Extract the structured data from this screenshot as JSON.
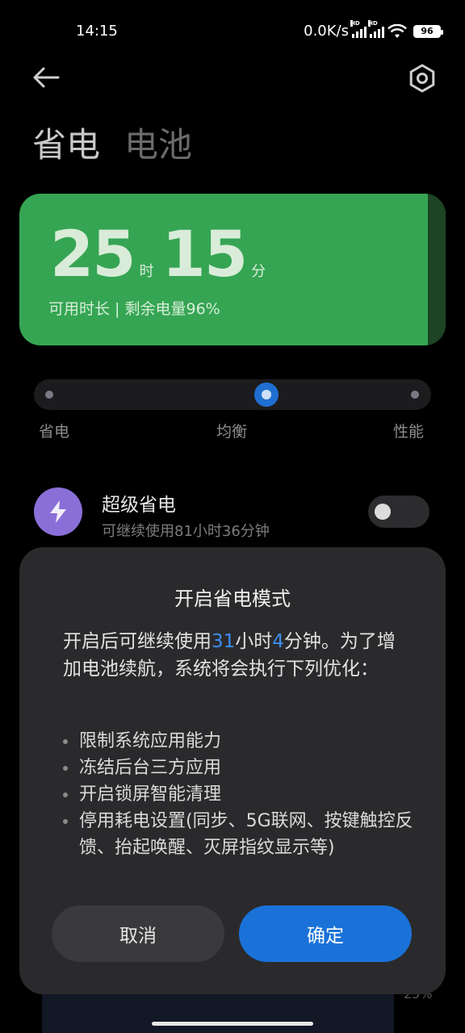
{
  "status_bar": {
    "time": "14:15",
    "net_speed": "0.0K/s",
    "signal_tag": "HD",
    "battery": "96"
  },
  "header": {
    "tab_active": "省电",
    "tab_inactive": "电池"
  },
  "battery_card": {
    "hours": "25",
    "hours_unit": "时",
    "minutes": "15",
    "minutes_unit": "分",
    "subtitle": "可用时长 | 剩余电量96%",
    "color": "#35a553"
  },
  "mode_slider": {
    "options": [
      "省电",
      "均衡",
      "性能"
    ],
    "selected": "均衡"
  },
  "super_saving": {
    "title": "超级省电",
    "subtitle": "可继续使用81小时36分钟",
    "enabled": false
  },
  "dialog": {
    "title": "开启省电模式",
    "body_pre": "开启后可继续使用",
    "hours": "31",
    "body_mid": "小时",
    "minutes": "4",
    "body_post": "分钟。为了增加电池续航，系统将会执行下列优化：",
    "items": [
      "限制系统应用能力",
      "冻结后台三方应用",
      "开启锁屏智能清理",
      "停用耗电设置(同步、5G联网、按键触控反馈、抬起唤醒、灭屏指纹显示等)"
    ],
    "cancel_label": "取消",
    "confirm_label": "确定",
    "accent": "#1a72d9"
  },
  "background": {
    "partial_percent": "25%"
  }
}
